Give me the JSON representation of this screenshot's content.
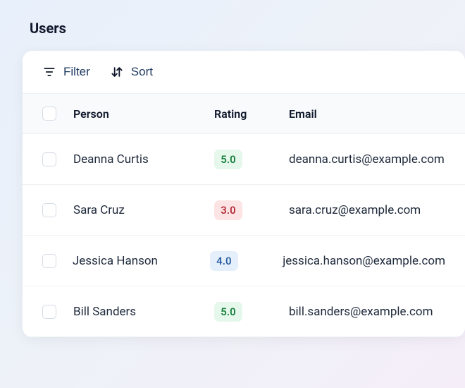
{
  "page": {
    "title": "Users"
  },
  "toolbar": {
    "filter_label": "Filter",
    "sort_label": "Sort"
  },
  "table": {
    "headers": {
      "person": "Person",
      "rating": "Rating",
      "email": "Email"
    },
    "rows": [
      {
        "person": "Deanna Curtis",
        "rating": "5.0",
        "rating_color": "green",
        "email": "deanna.curtis@example.com"
      },
      {
        "person": "Sara Cruz",
        "rating": "3.0",
        "rating_color": "red",
        "email": "sara.cruz@example.com"
      },
      {
        "person": "Jessica Hanson",
        "rating": "4.0",
        "rating_color": "blue",
        "email": "jessica.hanson@example.com"
      },
      {
        "person": "Bill Sanders",
        "rating": "5.0",
        "rating_color": "green",
        "email": "bill.sanders@example.com"
      }
    ]
  },
  "colors": {
    "rating_green_bg": "#e6f7ec",
    "rating_green_fg": "#16803c",
    "rating_red_bg": "#fde4e4",
    "rating_red_fg": "#b42c3a",
    "rating_blue_bg": "#e4effb",
    "rating_blue_fg": "#2b5fa3"
  }
}
